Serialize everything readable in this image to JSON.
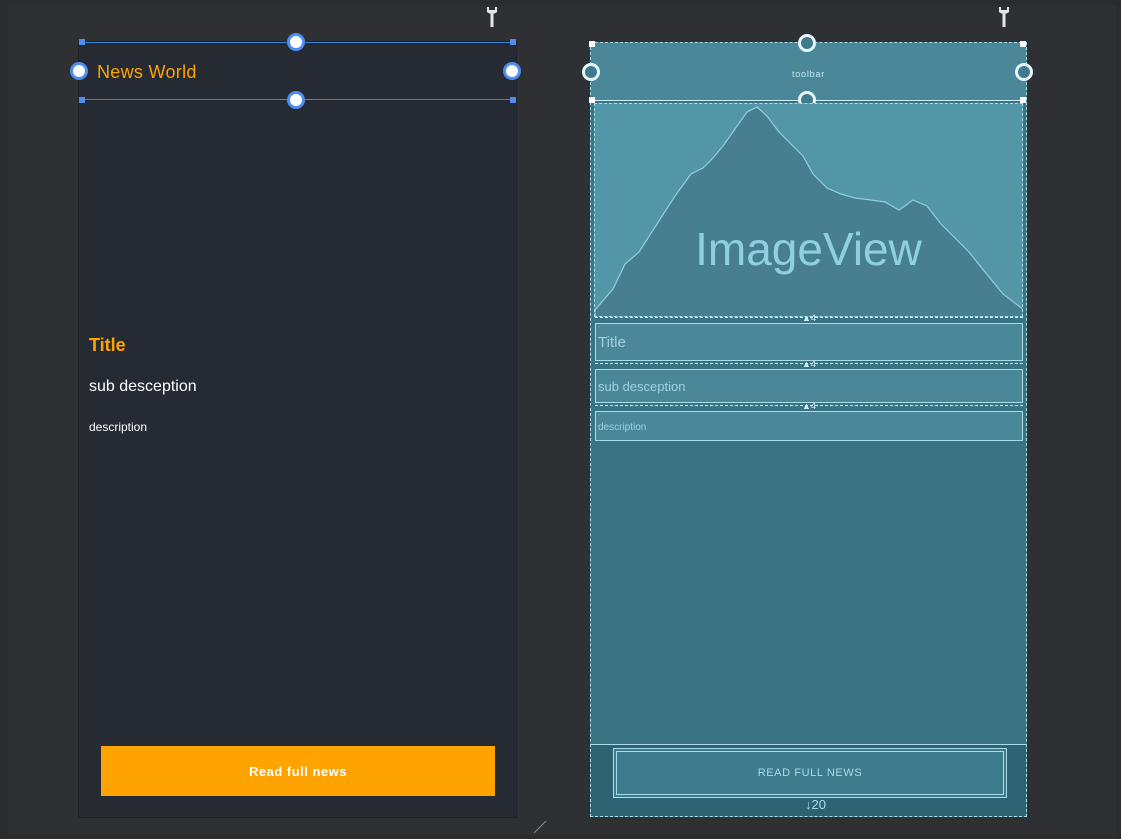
{
  "design": {
    "toolbar_title": "News World",
    "title": "Title",
    "sub_description": "sub desception",
    "description": "description",
    "button_label": "Read full news",
    "accent": "#ffa300",
    "background": "#262a33"
  },
  "blueprint": {
    "toolbar_label": "toolbar",
    "image_label": "ImageView",
    "title": "Title",
    "sub_description": "sub desception",
    "description": "description",
    "button_label": "READ FULL NEWS",
    "bottom_margin": "20",
    "background": "#3a7384"
  }
}
